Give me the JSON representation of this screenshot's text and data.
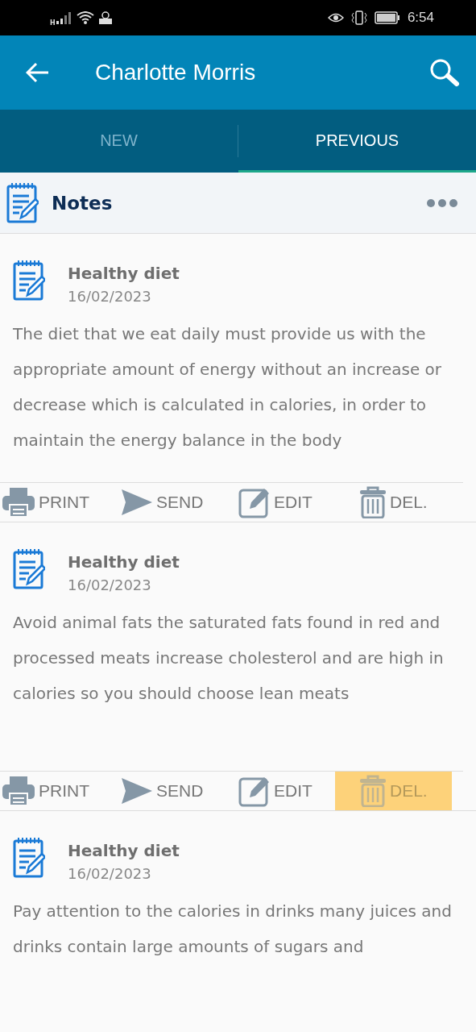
{
  "status_bar": {
    "network_type": "H",
    "time": "6:54"
  },
  "app_bar": {
    "title": "Charlotte Morris"
  },
  "tabs": [
    {
      "label": "NEW",
      "selected": false
    },
    {
      "label": "PREVIOUS",
      "selected": true
    }
  ],
  "section": {
    "title": "Notes"
  },
  "notes": [
    {
      "title": "Healthy diet",
      "date": "16/02/2023",
      "body": "The diet that we eat daily must provide us with the appropriate amount of energy without an increase or decrease which is calculated in calories, in order to maintain the energy balance in the body",
      "actions": [
        {
          "kind": "print",
          "label": "PRINT",
          "highlighted": false
        },
        {
          "kind": "send",
          "label": "SEND",
          "highlighted": false
        },
        {
          "kind": "edit",
          "label": "EDIT",
          "highlighted": false
        },
        {
          "kind": "delete",
          "label": "DEL.",
          "highlighted": false
        }
      ]
    },
    {
      "title": "Healthy diet",
      "date": "16/02/2023",
      "body": "Avoid animal fats the saturated fats found in red and processed meats increase cholesterol and are high in calories so you should choose lean meats",
      "actions": [
        {
          "kind": "print",
          "label": "PRINT",
          "highlighted": false
        },
        {
          "kind": "send",
          "label": "SEND",
          "highlighted": false
        },
        {
          "kind": "edit",
          "label": "EDIT",
          "highlighted": false
        },
        {
          "kind": "delete",
          "label": "DEL.",
          "highlighted": true
        }
      ]
    },
    {
      "title": "Healthy diet",
      "date": "16/02/2023",
      "body": "Pay attention to the calories in drinks many juices and drinks contain large amounts of sugars and"
    }
  ]
}
